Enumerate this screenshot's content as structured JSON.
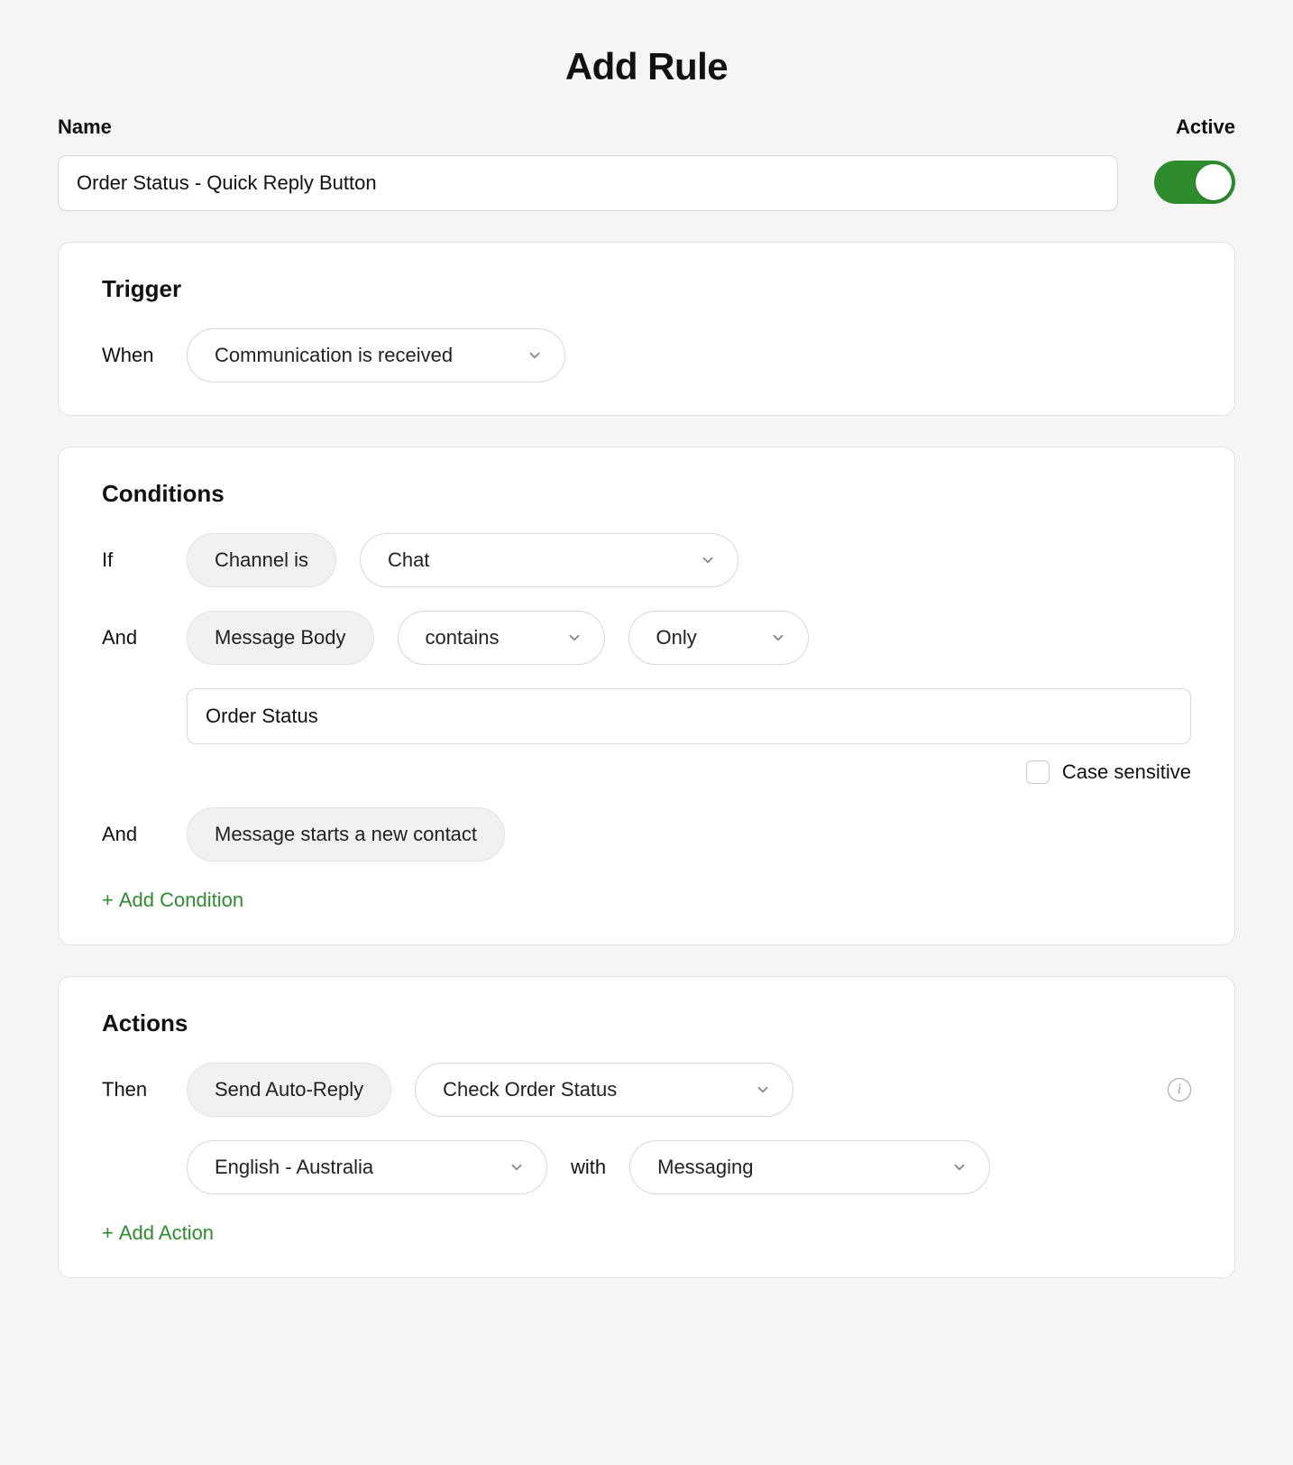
{
  "title": "Add Rule",
  "colors": {
    "accent": "#2e8b2e"
  },
  "name": {
    "label": "Name",
    "value": "Order Status - Quick Reply Button"
  },
  "active": {
    "label": "Active",
    "on": true
  },
  "trigger": {
    "heading": "Trigger",
    "prefix": "When",
    "event": "Communication is received"
  },
  "conditions": {
    "heading": "Conditions",
    "rows": [
      {
        "prefix": "If",
        "field": "Channel is",
        "value": "Chat"
      },
      {
        "prefix": "And",
        "field": "Message Body",
        "op": "contains",
        "scope": "Only",
        "text_value": "Order Status",
        "case_sensitive_label": "Case sensitive",
        "case_sensitive": false
      },
      {
        "prefix": "And",
        "field": "Message starts a new contact"
      }
    ],
    "add_label": "Add Condition"
  },
  "actions": {
    "heading": "Actions",
    "rows": [
      {
        "prefix": "Then",
        "action": "Send Auto-Reply",
        "template": "Check Order Status",
        "language": "English - Australia",
        "with_label": "with",
        "channel": "Messaging"
      }
    ],
    "add_label": "Add Action"
  }
}
